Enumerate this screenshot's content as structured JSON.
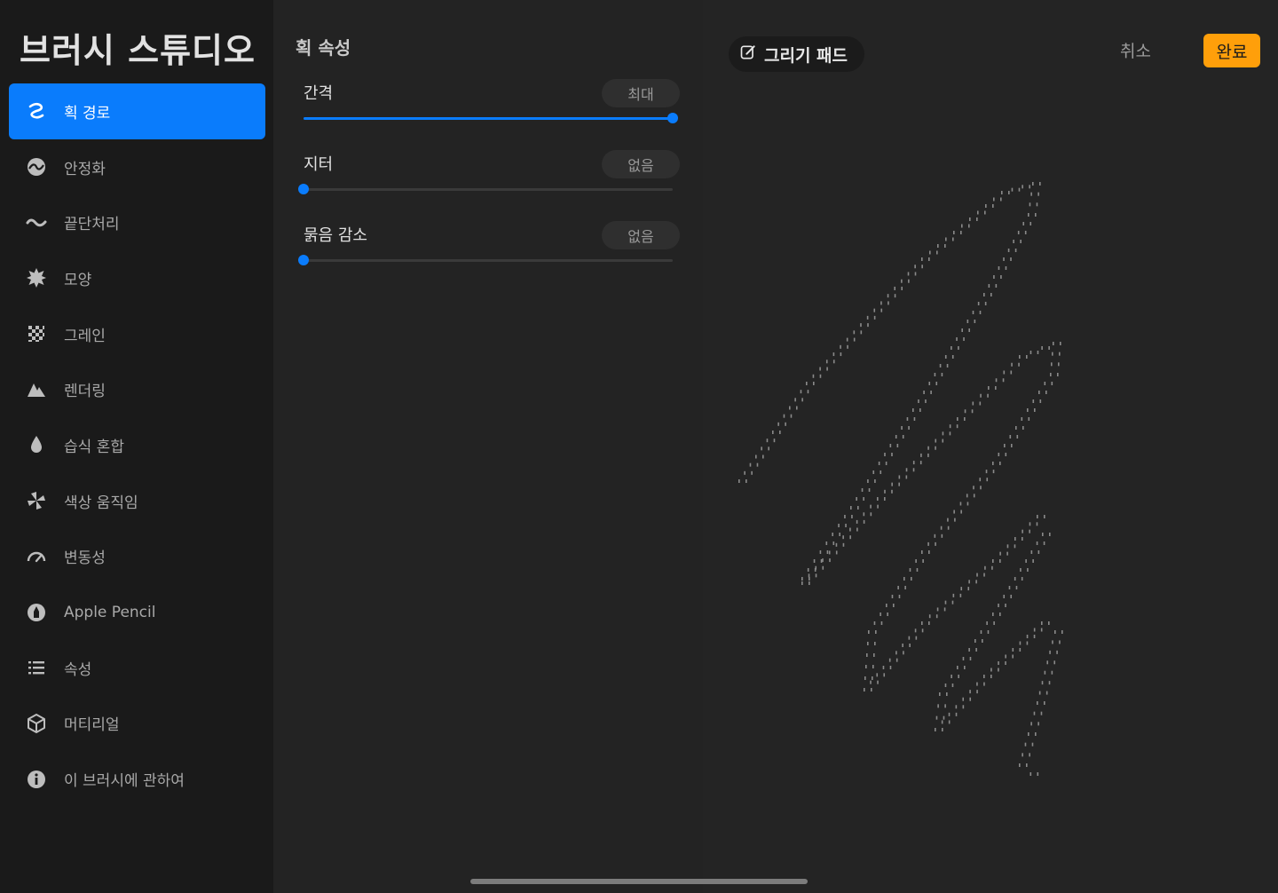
{
  "app_title": "브러시 스튜디오",
  "sidebar": {
    "items": [
      {
        "label": "획 경로",
        "icon": "stroke-path-icon",
        "active": true
      },
      {
        "label": "안정화",
        "icon": "stabilization-icon"
      },
      {
        "label": "끝단처리",
        "icon": "taper-icon"
      },
      {
        "label": "모양",
        "icon": "shape-icon"
      },
      {
        "label": "그레인",
        "icon": "grain-icon"
      },
      {
        "label": "렌더링",
        "icon": "rendering-icon"
      },
      {
        "label": "습식 혼합",
        "icon": "wet-mix-icon"
      },
      {
        "label": "색상 움직임",
        "icon": "color-dynamics-icon"
      },
      {
        "label": "변동성",
        "icon": "dynamics-icon"
      },
      {
        "label": "Apple Pencil",
        "icon": "apple-pencil-icon"
      },
      {
        "label": "속성",
        "icon": "properties-icon"
      },
      {
        "label": "머티리얼",
        "icon": "materials-icon"
      },
      {
        "label": "이 브러시에 관하여",
        "icon": "about-icon"
      }
    ]
  },
  "settings": {
    "section_title": "획 속성",
    "params": [
      {
        "label": "간격",
        "value_text": "최대",
        "level": 1.0
      },
      {
        "label": "지터",
        "value_text": "없음",
        "level": 0.0
      },
      {
        "label": "묽음 감소",
        "value_text": "없음",
        "level": 0.0
      }
    ]
  },
  "pad": {
    "button_label": "그리기 패드",
    "cancel_label": "취소",
    "done_label": "완료",
    "accent": "#ff9f0a"
  },
  "colors": {
    "active": "#0a7cfc",
    "done": "#ff9f0a"
  }
}
